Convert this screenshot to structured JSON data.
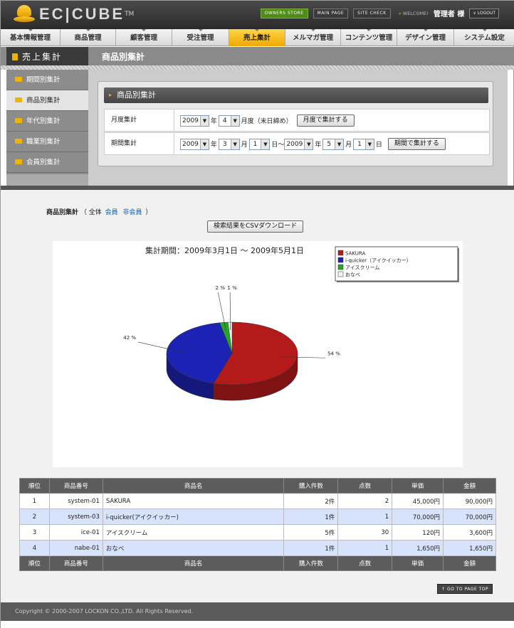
{
  "header": {
    "logo_text": "EC|CUBE",
    "logo_tm": "TM",
    "links": [
      "OWNERS STORE",
      "MAIN PAGE",
      "SITE CHECK"
    ],
    "welcome": "WELCOME!",
    "admin_name": "管理者 様",
    "logout": "LOGOUT"
  },
  "nav": [
    "基本情報管理",
    "商品管理",
    "顧客管理",
    "受注管理",
    "売上集計",
    "メルマガ管理",
    "コンテンツ管理",
    "デザイン管理",
    "システム設定"
  ],
  "section_title": "売上集計",
  "page_title": "商品別集計",
  "sidebar": [
    "期間別集計",
    "商品別集計",
    "年代別集計",
    "職業別集計",
    "会員別集計"
  ],
  "search": {
    "title": "商品別集計",
    "monthly": {
      "label": "月度集計",
      "year": "2009",
      "year_unit": "年",
      "month": "4",
      "month_unit": "月度（末日締め）",
      "button": "月度で集計する"
    },
    "period": {
      "label": "期間集計",
      "from_year": "2009",
      "from_month": "3",
      "from_day": "1",
      "to_year": "2009",
      "to_month": "5",
      "to_day": "1",
      "unit_year": "年",
      "unit_month": "月",
      "unit_day": "日",
      "tilde": "〜",
      "button": "期間で集計する"
    }
  },
  "result": {
    "title": "商品別集計",
    "paren_open": "（ 全体",
    "member": "会員",
    "nonmember": "非会員",
    "paren_close": "）",
    "csv_button": "検索結果をCSVダウンロード"
  },
  "chart_data": {
    "type": "pie",
    "title": "集計期間：2009年3月1日 〜 2009年5月1日",
    "labels": [
      "SAKURA",
      "i-quicker（アイクイッカー）",
      "アイスクリーム",
      "おなべ"
    ],
    "values": [
      54,
      42,
      2,
      1
    ],
    "value_labels": [
      "54 %",
      "42 %",
      "2 %",
      "1 %"
    ],
    "colors": [
      "#b51a1a",
      "#1c22b3",
      "#26a626",
      "#f4f4f4"
    ],
    "legend_position": "top-right"
  },
  "table": {
    "headers": [
      "順位",
      "商品番号",
      "商品名",
      "購入件数",
      "点数",
      "単価",
      "金額"
    ],
    "rows": [
      [
        "1",
        "system-01",
        "SAKURA",
        "2件",
        "2",
        "45,000円",
        "90,000円"
      ],
      [
        "2",
        "system-03",
        "i-quicker(アイクイッカー)",
        "1件",
        "1",
        "70,000円",
        "70,000円"
      ],
      [
        "3",
        "ice-01",
        "アイスクリーム",
        "5件",
        "30",
        "120円",
        "3,600円"
      ],
      [
        "4",
        "nabe-01",
        "おなべ",
        "1件",
        "1",
        "1,650円",
        "1,650円"
      ]
    ]
  },
  "page_top": "GO TO PAGE TOP",
  "footer": "Copyright © 2000-2007 LOCKON CO.,LTD. All Rights Reserved."
}
